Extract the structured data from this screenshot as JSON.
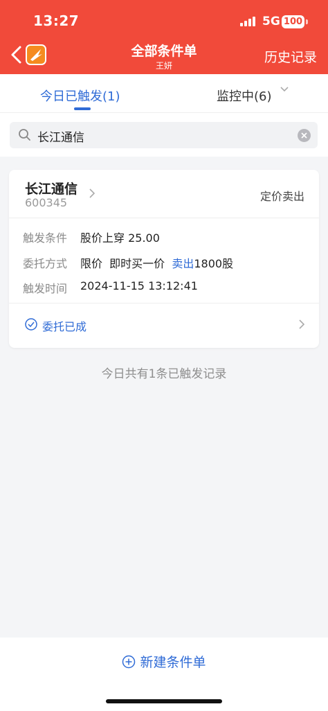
{
  "status_bar": {
    "time": "13:27",
    "network": "5G",
    "battery": "100"
  },
  "nav": {
    "title": "全部条件单",
    "subtitle": "王妍",
    "right_label": "历史记录"
  },
  "tabs": [
    {
      "label": "今日已触发(1)",
      "active": true
    },
    {
      "label": "监控中(6)",
      "active": false
    }
  ],
  "search": {
    "value": "长江通信"
  },
  "card": {
    "stock_name": "长江通信",
    "stock_code": "600345",
    "order_type": "定价卖出",
    "rows": [
      {
        "label": "触发条件",
        "value": "股价上穿 25.00"
      },
      {
        "label": "委托方式",
        "value_prefix": "限价  即时买一价  ",
        "value_highlight": "卖出",
        "value_suffix": "1800股"
      },
      {
        "label": "触发时间",
        "value": "2024-11-15 13:12:41"
      }
    ],
    "status": "委托已成"
  },
  "summary": "今日共有1条已触发记录",
  "bottom": {
    "new_button": "新建条件单"
  },
  "colors": {
    "header": "#f14a3a",
    "accent": "#2f6bd6"
  }
}
